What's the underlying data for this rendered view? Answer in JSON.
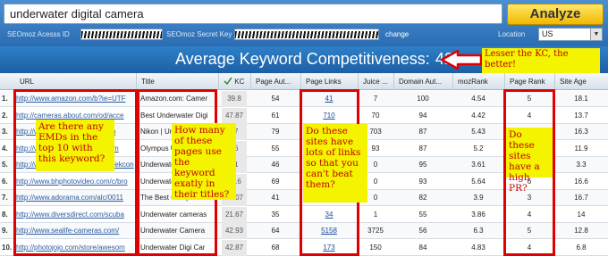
{
  "search": {
    "keyword": "underwater digital camera",
    "analyze_label": "Analyze"
  },
  "credentials": {
    "access_id_label": "SEOmoz Acesss ID",
    "secret_key_label": "SEOmoz Secret Key",
    "change_label": "change"
  },
  "location": {
    "label": "Location",
    "selected": "US"
  },
  "banner": {
    "label": "Average Keyword Competitiveness:",
    "value": "42"
  },
  "table": {
    "headers": [
      "URL",
      "Title",
      "KC",
      "Page Aut...",
      "Page Links",
      "Juice ...",
      "Domain Aut...",
      "mozRank",
      "Page Rank",
      "Site Age"
    ],
    "rows": [
      {
        "n": "1.",
        "url": "http://www.amazon.com/b?ie=UTF",
        "title": "Amazon.com: Camer",
        "kc": "39.8",
        "pa": "54",
        "links": "41",
        "juice": "7",
        "da": "100",
        "mr": "4.54",
        "pr": "5",
        "age": "18.1"
      },
      {
        "n": "2.",
        "url": "http://cameras.about.com/od/acce",
        "title": "Best Underwater Digi",
        "kc": "47.87",
        "pa": "61",
        "links": "710",
        "juice": "70",
        "da": "94",
        "mr": "4.42",
        "pr": "4",
        "age": "13.7"
      },
      {
        "n": "3.",
        "url": "http://www.nikonusa.com/Nikon",
        "title": "Nikon | Underwater",
        "kc": "67",
        "pa": "79",
        "links": "",
        "juice": "703",
        "da": "87",
        "mr": "5.43",
        "pr": "",
        "age": "16.3"
      },
      {
        "n": "4.",
        "url": "http://www.olympusamerica.com",
        "title": "Olympus Underwater",
        "kc": "46",
        "pa": "55",
        "links": "",
        "juice": "93",
        "da": "87",
        "mr": "5.2",
        "pr": "",
        "age": "11.9"
      },
      {
        "n": "5.",
        "url": "http://www.popphoto.com/gear/ekcon",
        "title": "Underwater Digital",
        "kc": "41",
        "pa": "46",
        "links": "",
        "juice": "0",
        "da": "95",
        "mr": "3.61",
        "pr": "",
        "age": "3.3"
      },
      {
        "n": "6.",
        "url": "http://www.bhphotovideo.com/c/bro",
        "title": "Underwater Digital C",
        "kc": "45.6",
        "pa": "69",
        "links": "",
        "juice": "0",
        "da": "93",
        "mr": "5.64",
        "pr": "6",
        "age": "16.6"
      },
      {
        "n": "7.",
        "url": "http://www.adorama.com/alc/0011",
        "title": "The Best Compact Di",
        "kc": "28.07",
        "pa": "41",
        "links": "",
        "juice": "0",
        "da": "82",
        "mr": "3.9",
        "pr": "3",
        "age": "16.7"
      },
      {
        "n": "8.",
        "url": "http://www.diversdirect.com/scuba",
        "title": "Underwater cameras",
        "kc": "21.67",
        "pa": "35",
        "links": "34",
        "juice": "1",
        "da": "55",
        "mr": "3.86",
        "pr": "4",
        "age": "14"
      },
      {
        "n": "9.",
        "url": "http://www.sealife-cameras.com/",
        "title": "Underwater Camera",
        "kc": "42.93",
        "pa": "64",
        "links": "5158",
        "juice": "3725",
        "da": "56",
        "mr": "6.3",
        "pr": "5",
        "age": "12.8"
      },
      {
        "n": "10.",
        "url": "http://photojojo.com/store/awesom",
        "title": "Underwater Digi Car",
        "kc": "42.87",
        "pa": "68",
        "links": "173",
        "juice": "150",
        "da": "84",
        "mr": "4.83",
        "pr": "4",
        "age": "6.8"
      }
    ]
  },
  "notes": {
    "kc_note": "Lesser the KC, the better!",
    "emd_note": "Are there any EMDs in the top 10 with this keyword?",
    "title_note": "How many of these pages use the keyword exatly in their titles?",
    "links_note": "Do these sites have lots of links so that you can't beat them?",
    "pr_note": "Do these sites have a high PR?"
  },
  "colors": {
    "highlight": "#e00000",
    "note_bg": "#f4f400",
    "note_text": "#c00000",
    "header_blue": "#2b6db3"
  }
}
